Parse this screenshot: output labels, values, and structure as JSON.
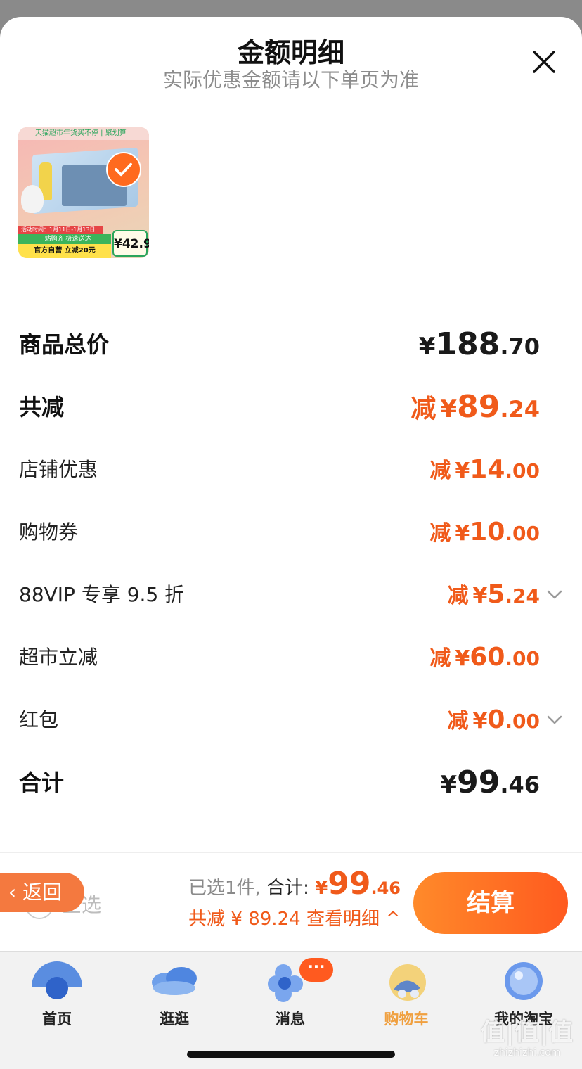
{
  "header": {
    "title": "金额明细",
    "subtitle": "实际优惠金额请以下单页为准"
  },
  "product": {
    "banner_text": "天猫超市年货买不停 | 聚划算",
    "date_text": "活动时间：1月11日-1月13日",
    "promo_green": "一站购齐 极速送达",
    "promo_yellow": "官方自营 立减20元",
    "price_tag": "¥42.9",
    "selected": true
  },
  "rows": [
    {
      "label": "商品总价",
      "prefix": "",
      "yen": "¥",
      "int": "188",
      "dec": ".70"
    },
    {
      "label": "共减",
      "prefix": "减",
      "yen": "¥",
      "int": "89",
      "dec": ".24"
    },
    {
      "label": "店铺优惠",
      "prefix": "减",
      "yen": "¥",
      "int": "14",
      "dec": ".00"
    },
    {
      "label": "购物券",
      "prefix": "减",
      "yen": "¥",
      "int": "10",
      "dec": ".00"
    },
    {
      "label": "88VIP 专享 9.5 折",
      "prefix": "减",
      "yen": "¥",
      "int": "5",
      "dec": ".24",
      "expandable": true
    },
    {
      "label": "超市立减",
      "prefix": "减",
      "yen": "¥",
      "int": "60",
      "dec": ".00"
    },
    {
      "label": "红包",
      "prefix": "减",
      "yen": "¥",
      "int": "0",
      "dec": ".00",
      "expandable": true
    },
    {
      "label": "合计",
      "prefix": "",
      "yen": "¥",
      "int": "99",
      "dec": ".46"
    }
  ],
  "checkout": {
    "back_label": "返回",
    "select_all_label": "全选",
    "selected_text": "已选1件,",
    "total_label": "合计:",
    "total_yen": "¥",
    "total_int": "99",
    "total_dec": ".46",
    "discount_text": "共减 ¥ 89.24",
    "detail_link": "查看明细 ^",
    "pay_label": "结算"
  },
  "tabbar": {
    "tabs": [
      {
        "label": "首页",
        "active": false
      },
      {
        "label": "逛逛",
        "active": false
      },
      {
        "label": "消息",
        "active": false
      },
      {
        "label": "购物车",
        "active": true
      },
      {
        "label": "我的淘宝",
        "active": false
      }
    ],
    "message_badge": "···"
  },
  "watermark": {
    "mark": "值|值|值",
    "site": "zhizhizhi.com"
  },
  "colors": {
    "accent": "#f05a1a",
    "pay_gradient_start": "#ff8a2a",
    "pay_gradient_end": "#ff5a1f",
    "active_tab": "#f0a040"
  }
}
